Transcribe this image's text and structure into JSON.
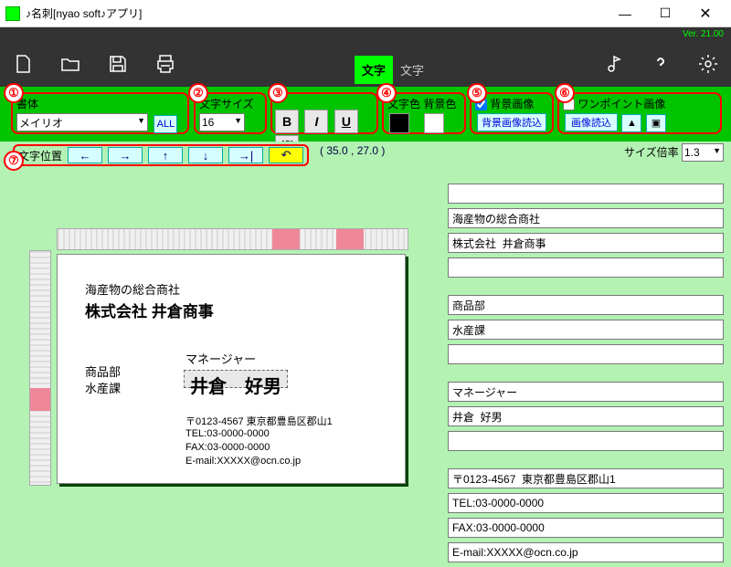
{
  "window": {
    "title": "♪名刺[nyao soft♪アプリ]",
    "version": "Ver. 21.00"
  },
  "tabs": {
    "active": "文字",
    "inactive": "文字"
  },
  "groups": {
    "font": {
      "num": "①",
      "label": "書体",
      "value": "メイリオ",
      "all": "ALL"
    },
    "size": {
      "num": "②",
      "label": "文字サイズ",
      "value": "16"
    },
    "style": {
      "num": "③",
      "b": "B",
      "i": "I",
      "u": "U",
      "v": "縦"
    },
    "color": {
      "num": "④",
      "label": "文字色 背景色"
    },
    "bg": {
      "num": "⑤",
      "chklabel": "背景画像",
      "btn": "背景画像読込"
    },
    "onepoint": {
      "num": "⑥",
      "chklabel": "ワンポイント画像",
      "btn": "画像読込"
    },
    "pos": {
      "num": "⑦",
      "label": "文字位置",
      "coords": "( 35.0 , 27.0 )"
    },
    "mul": {
      "label": "サイズ倍率",
      "value": "1.3"
    }
  },
  "card": {
    "l1": "海産物の総合商社",
    "l2": "株式会社  井倉商事",
    "l3": "マネージャー",
    "l4": "井倉　好男",
    "l5": "商品部",
    "l6": "水産課",
    "addr": "〒0123-4567  東京都豊島区郡山1",
    "tel": "TEL:03-0000-0000",
    "fax": "FAX:03-0000-0000",
    "mail": "E-mail:XXXXX@ocn.co.jp"
  },
  "inputs": {
    "f1": "",
    "f2": "海産物の総合商社",
    "f3": "株式会社  井倉商事",
    "f4": "",
    "f5": "商品部",
    "f6": "水産課",
    "f7": "",
    "f8": "マネージャー",
    "f9": "井倉  好男",
    "f10": "",
    "f11": "〒0123-4567  東京都豊島区郡山1",
    "f12": "TEL:03-0000-0000",
    "f13": "FAX:03-0000-0000",
    "f14": "E-mail:XXXXX@ocn.co.jp"
  }
}
